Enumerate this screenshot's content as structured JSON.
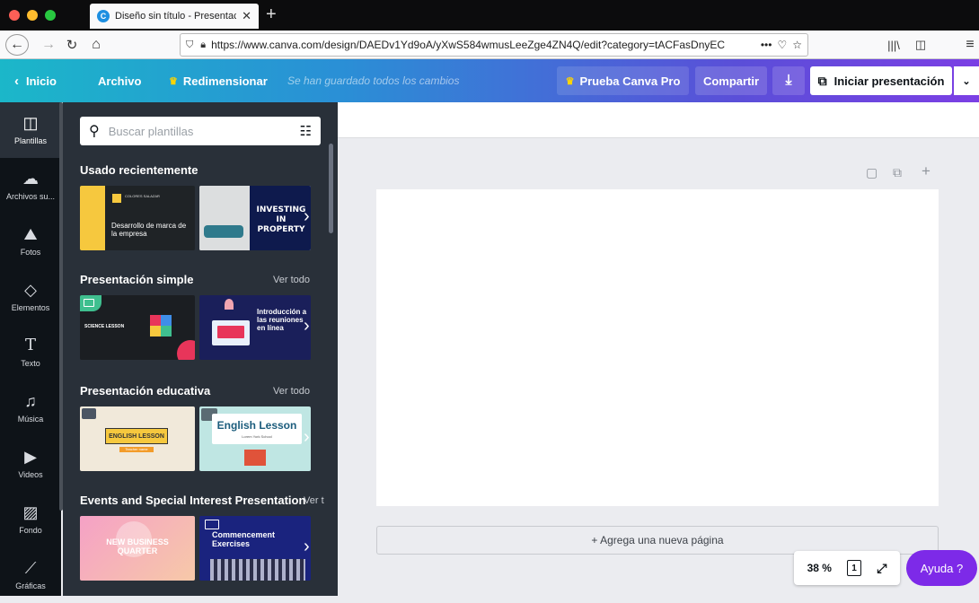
{
  "browser": {
    "tab_title": "Diseño sin título - Presentación",
    "tab_favicon": "C",
    "url": "https://www.canva.com/design/DAEDv1Yd9oA/yXwS584wmusLeeZge4ZN4Q/edit?category=tACFasDnyEC",
    "url_overflow": "•••"
  },
  "topbar": {
    "home": "Inicio",
    "file": "Archivo",
    "resize": "Redimensionar",
    "save_status": "Se han guardado todos los cambios",
    "pro_button": "Prueba Canva Pro",
    "share": "Compartir",
    "present": "Iniciar presentación"
  },
  "sidebar": {
    "items": [
      {
        "label": "Plantillas",
        "icon": "templates-icon"
      },
      {
        "label": "Archivos su...",
        "icon": "upload-cloud-icon"
      },
      {
        "label": "Fotos",
        "icon": "photo-icon"
      },
      {
        "label": "Elementos",
        "icon": "shapes-icon"
      },
      {
        "label": "Texto",
        "icon": "text-icon"
      },
      {
        "label": "Música",
        "icon": "music-icon"
      },
      {
        "label": "Videos",
        "icon": "video-icon"
      },
      {
        "label": "Fondo",
        "icon": "background-icon"
      },
      {
        "label": "Gráficas",
        "icon": "chart-icon"
      }
    ]
  },
  "panel": {
    "search_placeholder": "Buscar plantillas",
    "sections": [
      {
        "title": "Usado recientemente",
        "more": ""
      },
      {
        "title": "Presentación simple",
        "more": "Ver todo"
      },
      {
        "title": "Presentación educativa",
        "more": "Ver todo"
      },
      {
        "title": "Events and Special Interest Presentation",
        "more": "Ver t"
      }
    ],
    "thumbs": {
      "recent1_title": "Desarrollo de marca de la empresa",
      "recent1_brand": "COLORES SALAZAR",
      "recent2_text": "INVESTING IN PROPERTY",
      "simple1_text": "SCIENCE LESSON",
      "simple2_text": "Introducción a las reuniones en línea",
      "edu1_text": "ENGLISH LESSON",
      "edu1_sub": "Teacher name",
      "edu2_text": "English Lesson",
      "edu2_sub": "Lorem York School",
      "event1_text": "NEW BUSINESS QUARTER",
      "event2_text": "Commencement Exercises"
    }
  },
  "canvas": {
    "add_page": "+ Agrega una nueva página",
    "zoom": "38 %",
    "page_count": "1",
    "help": "Ayuda ?"
  },
  "colors": {
    "accent_purple": "#7d2ae8",
    "panel_bg": "#293039",
    "sidebar_bg": "#0e1318"
  }
}
